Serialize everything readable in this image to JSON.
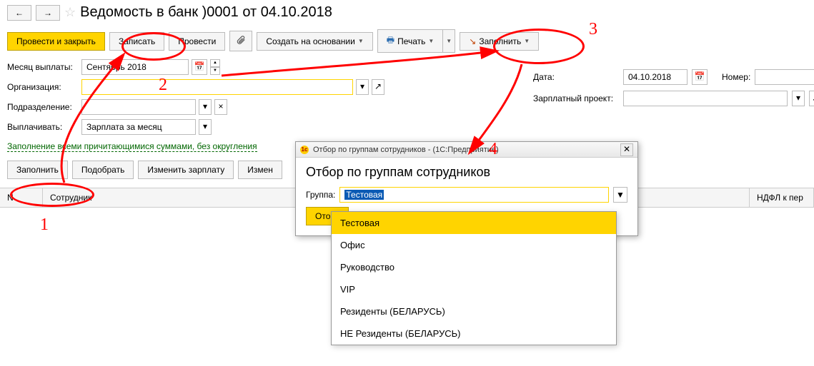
{
  "nav": {
    "back": "←",
    "forward": "→"
  },
  "star": "☆",
  "page_title": "Ведомость в банк         )0001 от 04.10.2018",
  "main_toolbar": {
    "post_close": "Провести и закрыть",
    "write": "Записать",
    "post": "Провести",
    "create_based": "Создать на основании",
    "print": "Печать",
    "fill": "Заполнить"
  },
  "fields": {
    "month_label": "Месяц выплаты:",
    "month_value": "Сентябрь 2018",
    "org_label": "Организация:",
    "org_value": "",
    "subdivision_label": "Подразделение:",
    "subdivision_value": "",
    "pay_label": "Выплачивать:",
    "pay_value": "Зарплата за месяц",
    "date_label": "Дата:",
    "date_value": "04.10.2018",
    "number_label": "Номер:",
    "number_value": "",
    "salary_proj_label": "Зарплатный проект:",
    "salary_proj_value": ""
  },
  "fill_link": "Заполнение всеми причитающимися суммами, без округления",
  "sub_toolbar": {
    "fill": "Заполнить",
    "pick": "Подобрать",
    "change_salary": "Изменить зарплату",
    "change": "Измен"
  },
  "table": {
    "col_n": "N",
    "col_employee": "Сотрудник",
    "col_ndfl": "НДФЛ к пер"
  },
  "dialog": {
    "titlebar": "Отбор по группам сотрудников -                              (1С:Предприятие)",
    "heading": "Отбор по группам сотрудников",
    "group_label": "Группа:",
    "group_value": "Тестовая",
    "select_btn": "Отобр"
  },
  "dropdown": {
    "items": [
      "Тестовая",
      "Офис",
      "Руководство",
      "VIP",
      "Резиденты (БЕЛАРУСЬ)",
      "НЕ Резиденты (БЕЛАРУСЬ)"
    ]
  },
  "annotations": {
    "n1": "1",
    "n2": "2",
    "n3": "3",
    "n4": "4"
  }
}
